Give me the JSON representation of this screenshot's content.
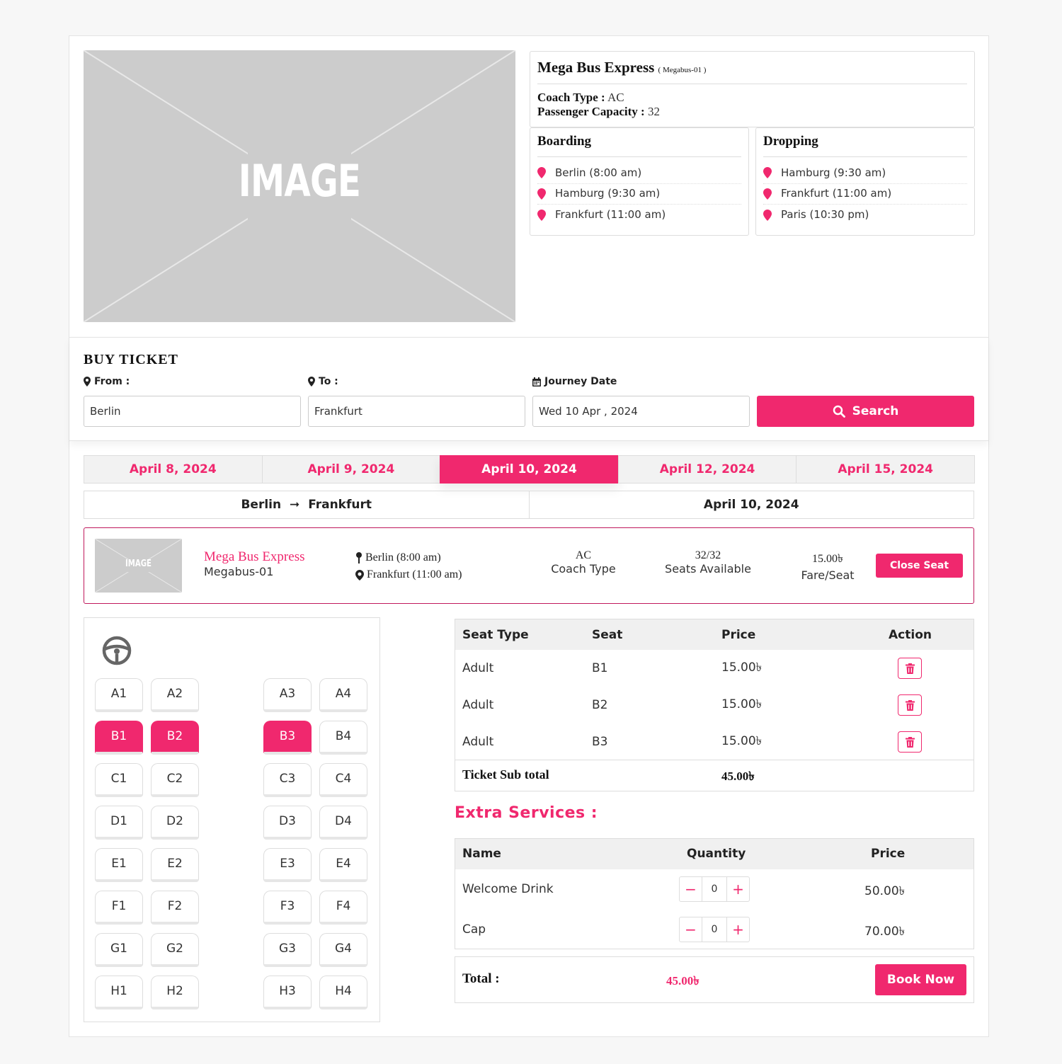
{
  "bus": {
    "image_text": "IMAGE",
    "name": "Mega Bus Express",
    "code": "( Megabus-01 )",
    "coach_type_label": "Coach Type :",
    "coach_type": "AC",
    "capacity_label": "Passenger Capacity :",
    "capacity": "32"
  },
  "boarding": {
    "title": "Boarding",
    "items": [
      "Berlin (8:00 am)",
      "Hamburg (9:30 am)",
      "Frankfurt (11:00 am)"
    ]
  },
  "dropping": {
    "title": "Dropping",
    "items": [
      "Hamburg (9:30 am)",
      "Frankfurt (11:00 am)",
      "Paris (10:30 pm)"
    ]
  },
  "buy": {
    "title": "BUY TICKET",
    "from_label": "From :",
    "to_label": "To :",
    "date_label": "Journey Date",
    "from_value": "Berlin",
    "to_value": "Frankfurt",
    "date_value": "Wed 10 Apr , 2024",
    "search_label": "Search"
  },
  "date_tabs": [
    "April 8, 2024",
    "April 9, 2024",
    "April 10, 2024",
    "April 12, 2024",
    "April 15, 2024"
  ],
  "active_tab": 2,
  "route": {
    "from": "Berlin",
    "to": "Frankfurt",
    "date": "April 10, 2024"
  },
  "result": {
    "image_text": "IMAGE",
    "name": "Mega Bus Express",
    "code": "Megabus-01",
    "start": "Berlin (8:00 am)",
    "end": "Frankfurt (11:00 am)",
    "coach_type": "AC",
    "coach_type_label": "Coach Type",
    "seats": "32/32",
    "seats_label": "Seats Available",
    "fare": "15.00৳",
    "fare_label": "Fare/Seat",
    "button": "Close Seat"
  },
  "seats": {
    "rows": [
      [
        "A1",
        "A2",
        "A3",
        "A4"
      ],
      [
        "B1",
        "B2",
        "B3",
        "B4"
      ],
      [
        "C1",
        "C2",
        "C3",
        "C4"
      ],
      [
        "D1",
        "D2",
        "D3",
        "D4"
      ],
      [
        "E1",
        "E2",
        "E3",
        "E4"
      ],
      [
        "F1",
        "F2",
        "F3",
        "F4"
      ],
      [
        "G1",
        "G2",
        "G3",
        "G4"
      ],
      [
        "H1",
        "H2",
        "H3",
        "H4"
      ]
    ],
    "selected": [
      "B1",
      "B2",
      "B3"
    ]
  },
  "ticket_table": {
    "headers": [
      "Seat Type",
      "Seat",
      "Price",
      "Action"
    ],
    "rows": [
      {
        "type": "Adult",
        "seat": "B1",
        "price": "15.00৳"
      },
      {
        "type": "Adult",
        "seat": "B2",
        "price": "15.00৳"
      },
      {
        "type": "Adult",
        "seat": "B3",
        "price": "15.00৳"
      }
    ],
    "subtotal_label": "Ticket Sub total",
    "subtotal": "45.00৳"
  },
  "extra": {
    "title": "Extra Services :",
    "headers": [
      "Name",
      "Quantity",
      "Price"
    ],
    "rows": [
      {
        "name": "Welcome Drink",
        "qty": "0",
        "price": "50.00৳"
      },
      {
        "name": "Cap",
        "qty": "0",
        "price": "70.00৳"
      }
    ],
    "minus": "−",
    "plus": "+"
  },
  "total": {
    "label": "Total :",
    "value": "45.00৳",
    "button": "Book Now"
  },
  "colors": {
    "accent": "#f0286e",
    "placeholder_image": "#cccccc"
  }
}
